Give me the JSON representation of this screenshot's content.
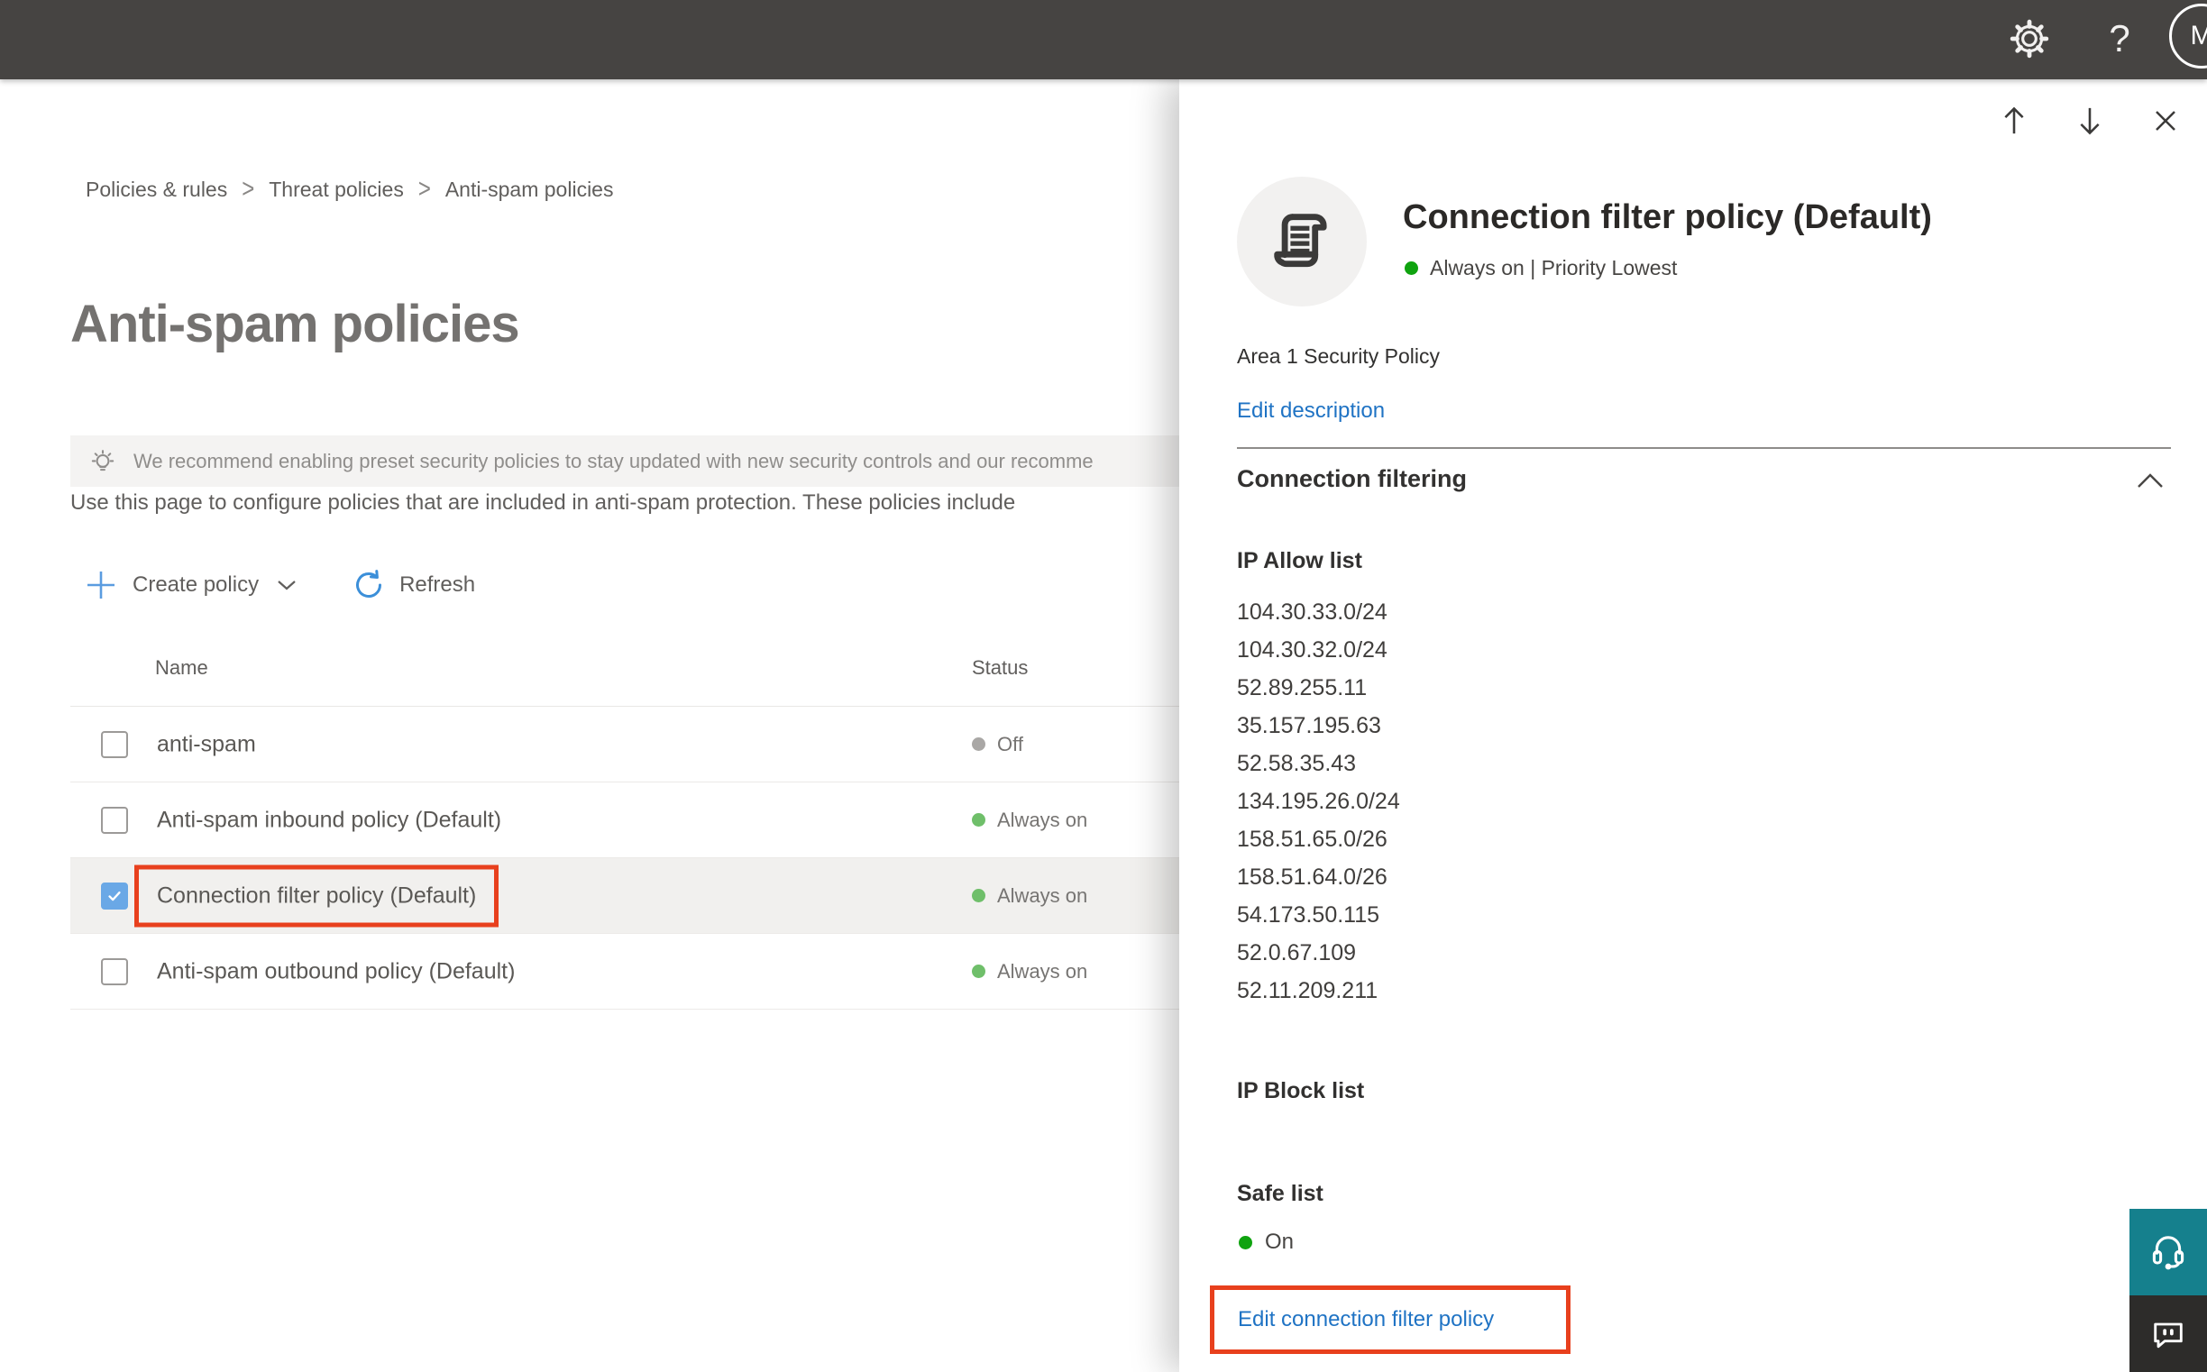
{
  "topbar": {
    "settings_icon": "gear-icon",
    "help_label": "?",
    "avatar_initial": "M"
  },
  "breadcrumb": {
    "items": [
      "Policies & rules",
      "Threat policies",
      "Anti-spam policies"
    ],
    "separator": ">"
  },
  "page": {
    "title": "Anti-spam policies",
    "banner_text": "We recommend enabling preset security policies to stay updated with new security controls and our recomme",
    "description": "Use this page to configure policies that are included in anti-spam protection. These policies include"
  },
  "toolbar": {
    "create_policy_label": "Create policy",
    "refresh_label": "Refresh"
  },
  "table": {
    "columns": [
      "Name",
      "Status"
    ],
    "rows": [
      {
        "name": "anti-spam",
        "status": "Off",
        "status_color": "gray",
        "checked": false,
        "selected": false,
        "boxed": false
      },
      {
        "name": "Anti-spam inbound policy (Default)",
        "status": "Always on",
        "status_color": "green",
        "checked": false,
        "selected": false,
        "boxed": false
      },
      {
        "name": "Connection filter policy (Default)",
        "status": "Always on",
        "status_color": "green",
        "checked": true,
        "selected": true,
        "boxed": true
      },
      {
        "name": "Anti-spam outbound policy (Default)",
        "status": "Always on",
        "status_color": "green",
        "checked": false,
        "selected": false,
        "boxed": false
      }
    ]
  },
  "flyout": {
    "title": "Connection filter policy (Default)",
    "status_line": "Always on | Priority Lowest",
    "description": "Area 1 Security Policy",
    "edit_description_label": "Edit description",
    "section_title": "Connection filtering",
    "ip_allow": {
      "label": "IP Allow list",
      "ips": [
        "104.30.33.0/24",
        "104.30.32.0/24",
        "52.89.255.11",
        "35.157.195.63",
        "52.58.35.43",
        "134.195.26.0/24",
        "158.51.65.0/26",
        "158.51.64.0/26",
        "54.173.50.115",
        "52.0.67.109",
        "52.11.209.211"
      ]
    },
    "ip_block_label": "IP Block list",
    "safe_list_label": "Safe list",
    "safe_list_value": "On",
    "edit_link_label": "Edit connection filter policy"
  },
  "colors": {
    "accent_blue": "#1f73c4",
    "highlight_red": "#e8401d",
    "status_green": "#6fbf6a",
    "flyout_green": "#0fa30f",
    "support_teal": "#15808d",
    "topbar_gray": "#464442"
  }
}
